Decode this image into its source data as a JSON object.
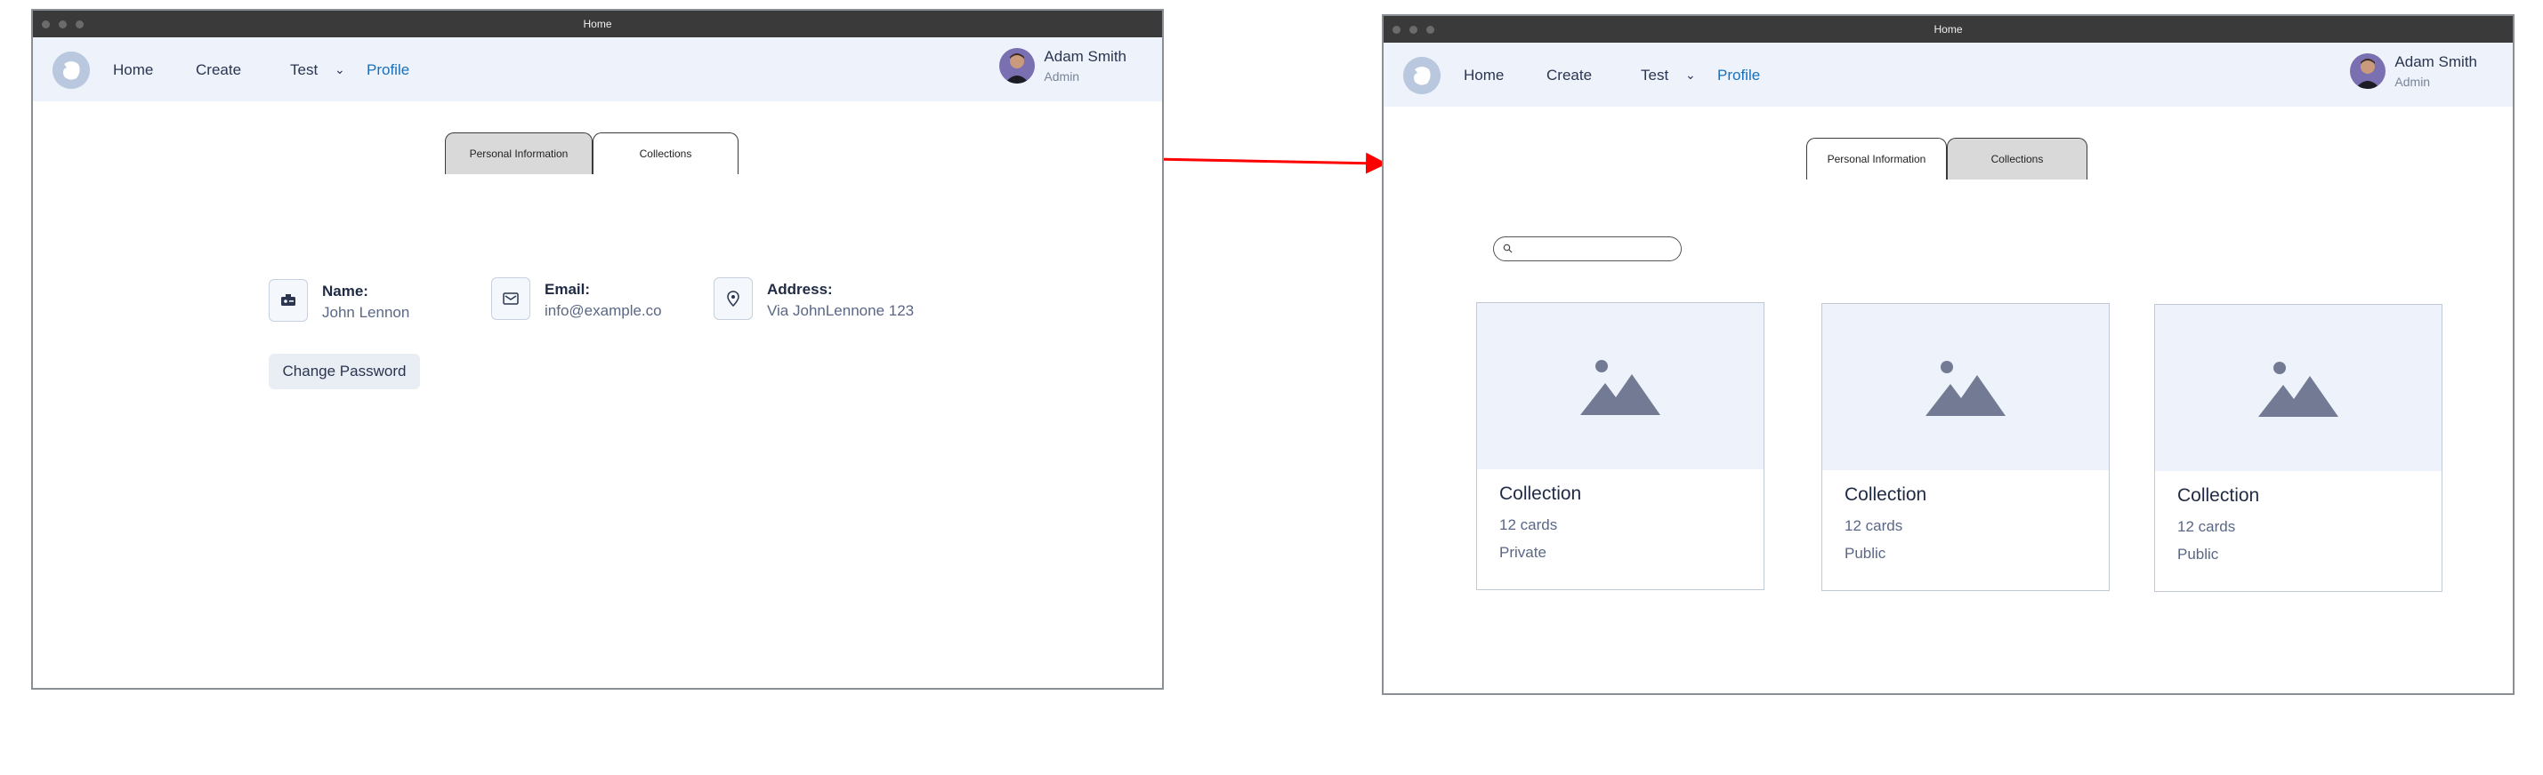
{
  "left_window": {
    "title": "Home",
    "nav": {
      "home": "Home",
      "create": "Create",
      "test": "Test",
      "test_chevron": "⌄",
      "profile": "Profile"
    },
    "user": {
      "name": "Adam Smith",
      "role": "Admin"
    },
    "tabs": {
      "personal": "Personal Information",
      "collections": "Collections"
    },
    "info": {
      "name_label": "Name:",
      "name_value": "John Lennon",
      "email_label": "Email:",
      "email_value": "info@example.co",
      "address_label": "Address:",
      "address_value": "Via JohnLennone 123"
    },
    "change_password": "Change Password"
  },
  "right_window": {
    "title": "Home",
    "nav": {
      "home": "Home",
      "create": "Create",
      "test": "Test",
      "test_chevron": "⌄",
      "profile": "Profile"
    },
    "user": {
      "name": "Adam Smith",
      "role": "Admin"
    },
    "tabs": {
      "personal": "Personal Information",
      "collections": "Collections"
    },
    "search": {
      "value": "",
      "placeholder": ""
    },
    "cards": [
      {
        "title": "Collection",
        "count": "12 cards",
        "visibility": "Private"
      },
      {
        "title": "Collection",
        "count": "12 cards",
        "visibility": "Public"
      },
      {
        "title": "Collection",
        "count": "12 cards",
        "visibility": "Public"
      }
    ]
  },
  "colors": {
    "active_nav": "#1b6fb8",
    "navbar_bg": "#eef3fb",
    "arrow": "#ff0000",
    "tab_inactive": "#d9d9d9"
  }
}
